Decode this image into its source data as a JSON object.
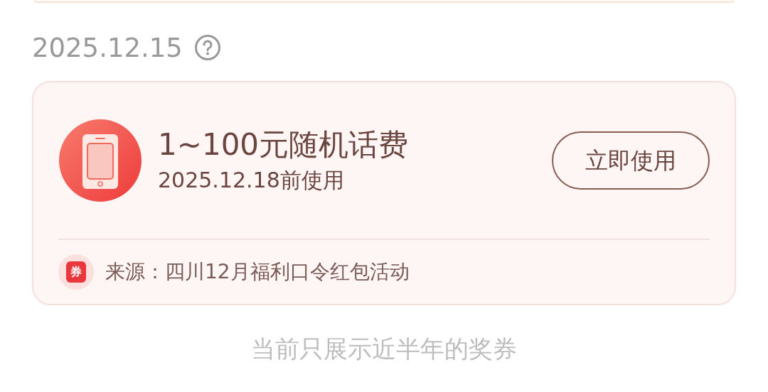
{
  "date_header": {
    "date": "2025.12.15"
  },
  "voucher": {
    "title": "1~100元随机话费",
    "expiry": "2025.12.18前使用",
    "button": "立即使用",
    "source_badge": "券",
    "source": "来源：四川12月福利口令红包活动"
  },
  "footer_note": "当前只展示近半年的奖券"
}
